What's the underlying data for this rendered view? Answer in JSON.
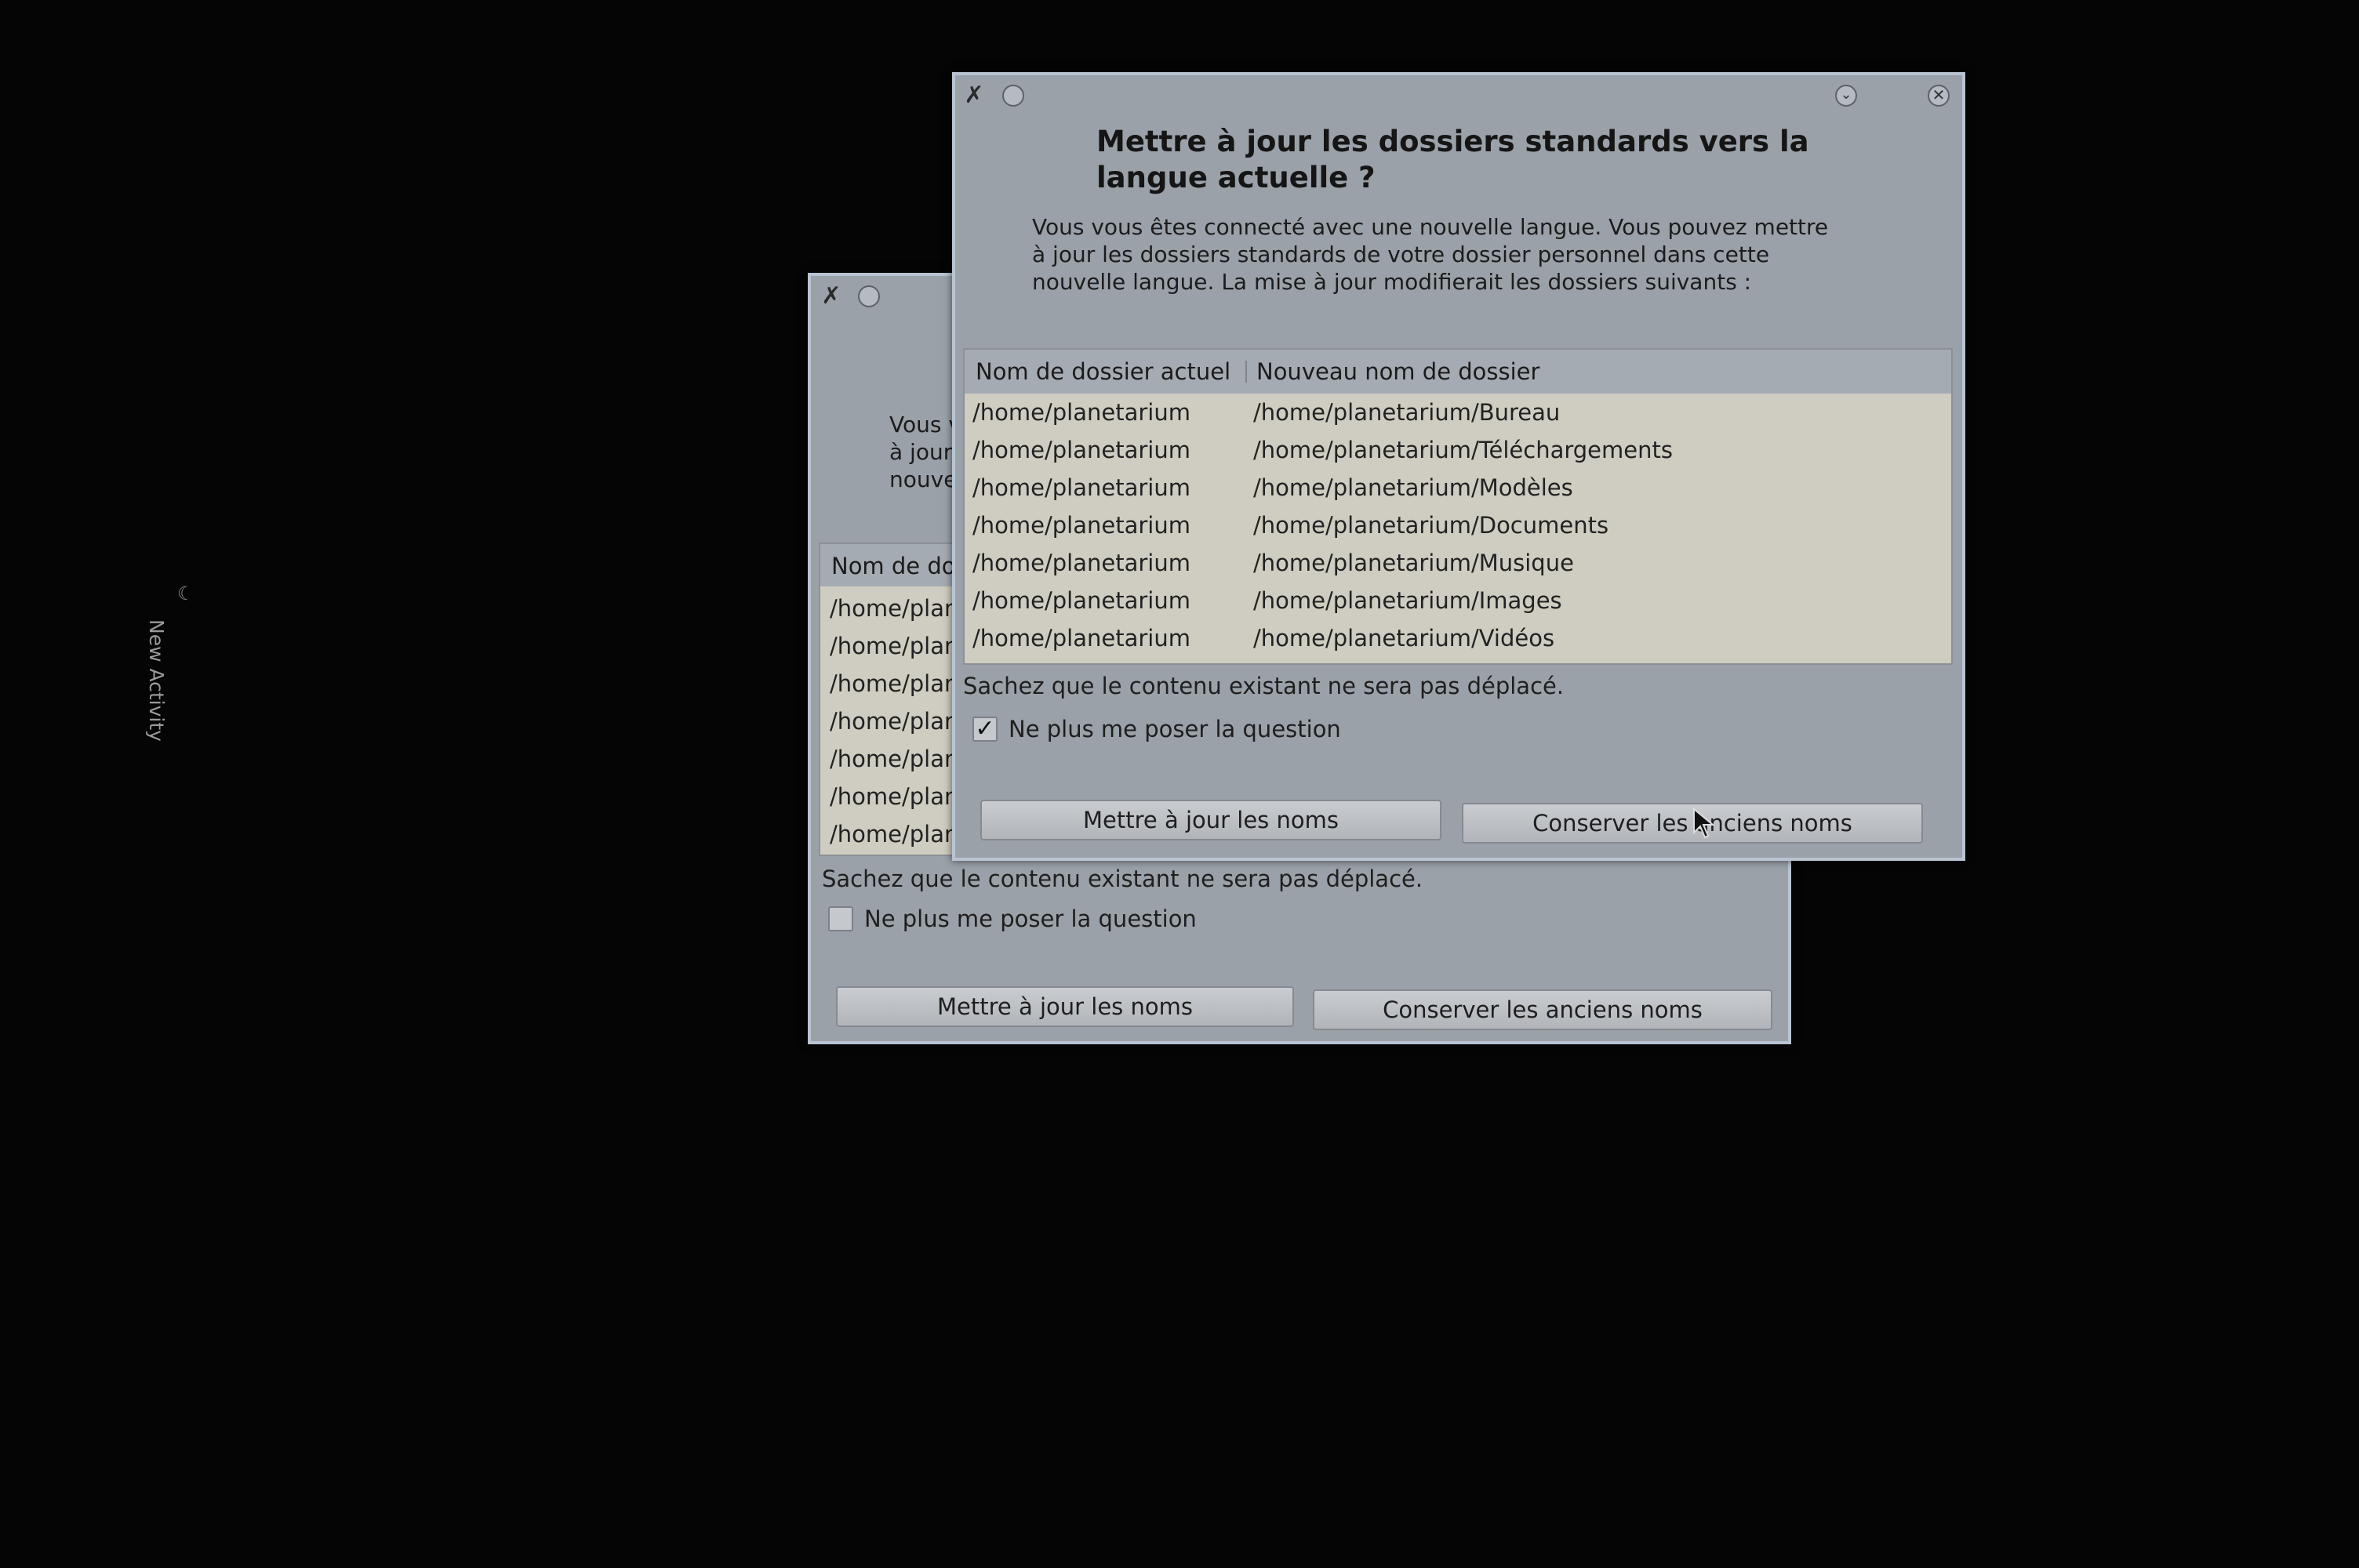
{
  "desktop": {
    "side_label": "New Activity"
  },
  "dialog": {
    "heading_line1": "Mettre à jour les dossiers standards vers la",
    "heading_line2": "langue actuelle ?",
    "desc_line1": "Vous vous êtes connecté avec une nouvelle langue. Vous pouvez mettre",
    "desc_line2": "à jour les dossiers standards de votre dossier personnel dans cette",
    "desc_line3": "nouvelle langue. La mise à jour modifierait les dossiers suivants :",
    "columns": [
      "Nom de dossier actuel",
      "Nouveau nom de dossier"
    ],
    "rows": [
      {
        "current": "/home/planetarium",
        "new": "/home/planetarium/Bureau"
      },
      {
        "current": "/home/planetarium",
        "new": "/home/planetarium/Téléchargements"
      },
      {
        "current": "/home/planetarium",
        "new": "/home/planetarium/Modèles"
      },
      {
        "current": "/home/planetarium",
        "new": "/home/planetarium/Documents"
      },
      {
        "current": "/home/planetarium",
        "new": "/home/planetarium/Musique"
      },
      {
        "current": "/home/planetarium",
        "new": "/home/planetarium/Images"
      },
      {
        "current": "/home/planetarium",
        "new": "/home/planetarium/Vidéos"
      }
    ],
    "note": "Sachez que le contenu existant ne sera pas déplacé.",
    "checkbox_label": "Ne plus me poser la question",
    "checkbox_checked": true,
    "update_button": "Mettre à jour les noms",
    "keep_button": "Conserver les anciens noms"
  },
  "back_dialog": {
    "desc_line1": "Vous v",
    "desc_line2": "à jour",
    "desc_line3": "nouve",
    "column": "Nom de do",
    "row_text": "/home/plan",
    "note": "Sachez que le contenu existant ne sera pas déplacé.",
    "checkbox_label": "Ne plus me poser la question",
    "checkbox_checked": false,
    "update_button": "Mettre à jour les noms",
    "keep_button": "Conserver les anciens noms"
  }
}
